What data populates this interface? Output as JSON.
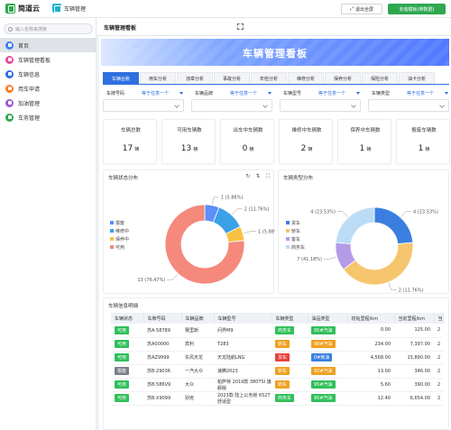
{
  "app": {
    "name": "简道云",
    "module": "车辆管理"
  },
  "header": {
    "exit_label": "退出全屏",
    "install_label": "安装模板(带数据)"
  },
  "sidebar": {
    "search_placeholder": "输入名称来搜索",
    "items": [
      {
        "label": "首页",
        "color": "#3d7ef0",
        "active": true
      },
      {
        "label": "车辆管理看板",
        "color": "#e44a9b",
        "active": false
      },
      {
        "label": "车辆信息",
        "color": "#2f6fe0",
        "active": false
      },
      {
        "label": "用车申请",
        "color": "#ff7a1a",
        "active": false
      },
      {
        "label": "加油管理",
        "color": "#9b59d0",
        "active": false
      },
      {
        "label": "车务管理",
        "color": "#2fa84f",
        "active": false
      }
    ]
  },
  "page_tab": "车辆管理看板",
  "banner_title": "车辆管理看板",
  "tabs": [
    "车辆台账",
    "用车分析",
    "违章分析",
    "事故分析",
    "年检分析",
    "维修分析",
    "保养分析",
    "保险分析",
    "油卡分析"
  ],
  "filters": [
    {
      "label": "车牌号码",
      "value": "等于任意一个"
    },
    {
      "label": "车辆品牌",
      "value": "等于任意一个"
    },
    {
      "label": "车辆型号",
      "value": "等于任意一个"
    },
    {
      "label": "车辆类型",
      "value": "等于任意一个"
    }
  ],
  "stats": [
    {
      "title": "车辆总数",
      "value": "17",
      "unit": "辆"
    },
    {
      "title": "可用车辆数",
      "value": "13",
      "unit": "辆"
    },
    {
      "title": "出车中车辆数",
      "value": "0",
      "unit": "辆"
    },
    {
      "title": "维修中车辆数",
      "value": "2",
      "unit": "辆"
    },
    {
      "title": "保养中车辆数",
      "value": "1",
      "unit": "辆"
    },
    {
      "title": "报废车辆数",
      "value": "1",
      "unit": "辆"
    }
  ],
  "status_panel": {
    "title": "车辆状态分布",
    "legend": [
      "报废",
      "维修中",
      "保养中",
      "可用"
    ],
    "slice_labels": [
      "1 (5.88%)",
      "2 (11.76%)",
      "1 (5.88%)",
      "13 (76.47%)"
    ]
  },
  "type_panel": {
    "title": "车辆类型分布",
    "legend": [
      "货车",
      "轿车",
      "客车",
      "商务车"
    ],
    "slice_labels": [
      "4 (23.53%)",
      "2 (11.76%)",
      "7 (41.18%)",
      "4 (23.53%)"
    ]
  },
  "chart_data": [
    {
      "type": "pie",
      "title": "车辆状态分布",
      "categories": [
        "报废",
        "维修中",
        "保养中",
        "可用"
      ],
      "values": [
        1,
        2,
        1,
        13
      ],
      "colors": [
        "#5b8ff9",
        "#3aa0e8",
        "#f6c244",
        "#f4897c"
      ],
      "legend": "left"
    },
    {
      "type": "pie",
      "title": "车辆类型分布",
      "categories": [
        "货车",
        "轿车",
        "客车",
        "商务车"
      ],
      "values": [
        4,
        7,
        2,
        4
      ],
      "colors": [
        "#3a7fe0",
        "#f6c66e",
        "#b49be8",
        "#bcdcf6"
      ],
      "legend": "left"
    }
  ],
  "table": {
    "title": "车辆信息明细",
    "headers": [
      "车辆状态",
      "车牌号码",
      "车辆品牌",
      "车辆型号",
      "车辆类型",
      "油品类型",
      "初始里程/km",
      "当前里程/km",
      "当"
    ],
    "rows": [
      {
        "status": "可用",
        "plate": "苏A·58789",
        "brand": "赛里斯",
        "model": "问界M9",
        "type": "商务车",
        "fuel": "95#汽油",
        "init": "0.00",
        "cur": "125.00",
        "x": "2"
      },
      {
        "status": "可用",
        "plate": "苏A00000",
        "brand": "宾利",
        "model": "T283",
        "type": "轿车",
        "fuel": "98#汽油",
        "init": "234.00",
        "cur": "7,397.00",
        "x": "2"
      },
      {
        "status": "可用",
        "plate": "苏AZ9999",
        "brand": "东风天龙",
        "model": "天龙陆航LNG",
        "type": "货车",
        "fuel": "0#柴油",
        "init": "4,568.00",
        "cur": "15,890.00",
        "x": "2"
      },
      {
        "status": "报废",
        "plate": "苏B·29036",
        "brand": "一汽大众",
        "model": "速腾2023",
        "type": "轿车",
        "fuel": "92#汽油",
        "init": "13.00",
        "cur": "346.00",
        "x": "2"
      },
      {
        "status": "可用",
        "plate": "苏B·586V9",
        "brand": "大众",
        "model": "帕萨特 2019款 380TSI 旗舰版",
        "type": "轿车",
        "fuel": "95#汽油",
        "init": "5.60",
        "cur": "390.00",
        "x": "2"
      },
      {
        "status": "可用",
        "plate": "苏B·X9099",
        "brand": "别克",
        "model": "2023款 陆上公务舱 652T 舒适型",
        "type": "商务车",
        "fuel": "95#汽油",
        "init": "12.40",
        "cur": "6,654.00",
        "x": "2"
      }
    ]
  },
  "colors": {
    "accent": "#2f6fe0",
    "brand_green": "#2fa84f",
    "status_available": "#2fbf5a",
    "status_scrapped": "#7a7f8a",
    "type_business": "#2fbf5a",
    "type_sedan": "#f0a020",
    "type_truck": "#e8423a",
    "fuel_95": "#2fbf5a",
    "fuel_98": "#f0a020",
    "fuel_diesel": "#3a7fe0",
    "fuel_92": "#f0a020"
  }
}
